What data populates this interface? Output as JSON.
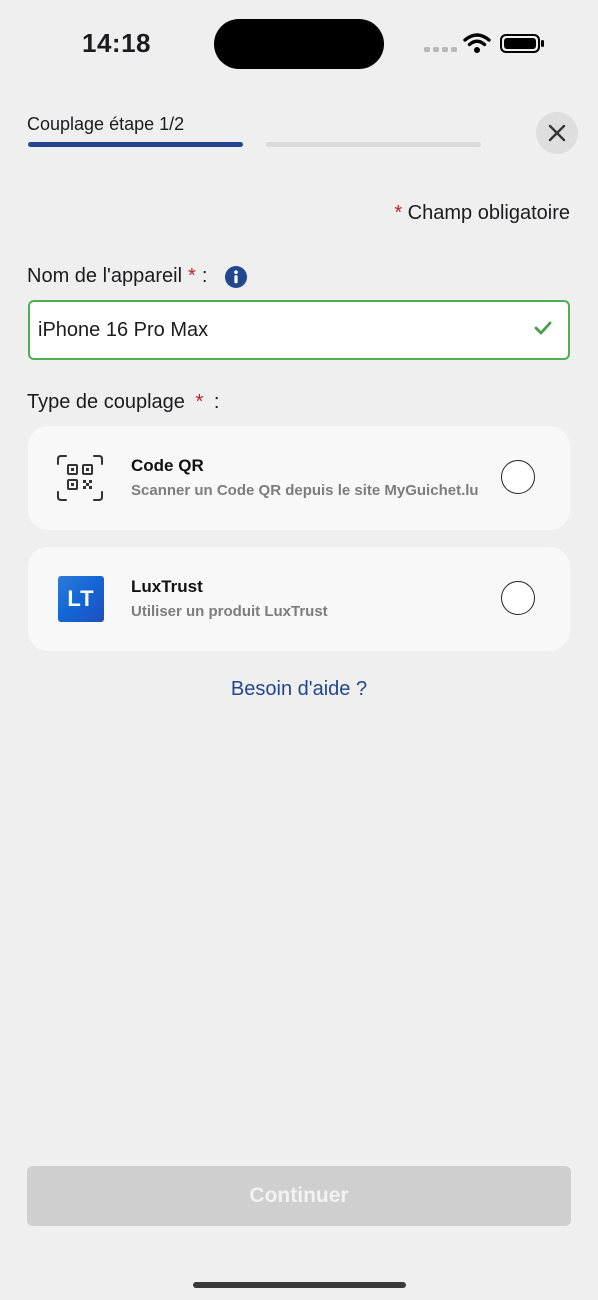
{
  "status_bar": {
    "time": "14:18"
  },
  "header": {
    "step_label": "Couplage étape 1/2",
    "progress": 0.5
  },
  "required_note": {
    "star": "*",
    "text": "Champ obligatoire"
  },
  "device_field": {
    "label": "Nom de l'appareil",
    "star": "*",
    "suffix": ":",
    "value": "iPhone 16 Pro Max"
  },
  "pairing": {
    "label": "Type de couplage",
    "star": "*",
    "suffix": ":",
    "options": [
      {
        "title": "Code QR",
        "description": "Scanner un Code QR depuis le site MyGuichet.lu",
        "icon": "qr-code-icon",
        "selected": false
      },
      {
        "title": "LuxTrust",
        "description": "Utiliser un produit LuxTrust",
        "icon": "luxtrust-logo",
        "logo_text": "LT",
        "selected": false
      }
    ]
  },
  "help_link": "Besoin d'aide ?",
  "continue_button": "Continuer",
  "colors": {
    "accent": "#22468f",
    "required": "#c0202a",
    "valid": "#4caf50",
    "disabled_button": "#cfcfcf"
  }
}
